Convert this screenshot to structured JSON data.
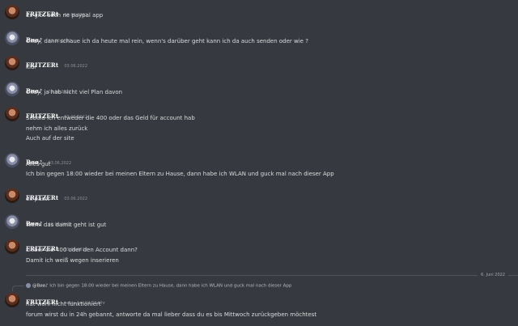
{
  "messages": [
    {
      "author": "FRITZERt",
      "date": "03.06.2022",
      "avatar": "fritzert-avatar",
      "lines": [
        "Es gibt auch ne paypal app"
      ]
    },
    {
      "author": "Bøø♪",
      "date": "03.06.2022",
      "avatar": "boo-avatar",
      "lines": [
        "Okay, dann schaue ich da heute mal rein, wenn's darüber geht kann ich da auch senden oder wie ?"
      ]
    },
    {
      "author": "FRITZERt",
      "date": "03.06.2022",
      "avatar": "fritzert-avatar",
      "lines": [
        "klar"
      ]
    },
    {
      "author": "Bøø♪",
      "date": "03.06.2022",
      "avatar": "boo-avatar",
      "lines": [
        "Okay, ja hab nicht viel Plan davon"
      ]
    },
    {
      "author": "FRITZERt",
      "date": "03.06.2022",
      "avatar": "fritzert-avatar",
      "lines": [
        "Sobald ich entweder die 400 oder das Geld für account hab",
        "nehm ich alles zurück",
        "Auch auf der site"
      ]
    },
    {
      "author": "Bøø♪",
      "date": "03.06.2022",
      "avatar": "boo-avatar",
      "lines": [
        "Alles gut",
        "Ich bin gegen 18:00 wieder bei meinen Eltern zu Hause, dann habe ich WLAN und guck mal nach dieser App"
      ]
    },
    {
      "author": "FRITZERt",
      "date": "03.06.2022",
      "avatar": "fritzert-avatar",
      "lines": [
        "ok passt"
      ]
    },
    {
      "author": "Bøø♪",
      "date": "03.06.2022",
      "avatar": "boo-avatar",
      "lines": [
        "Wenn das damit geht ist gut"
      ]
    },
    {
      "author": "FRITZERt",
      "date": "03.06.2022",
      "avatar": "fritzert-avatar",
      "lines": [
        "Lieber die 400 oder den Account dann?",
        "Damit ich weiß wegen inserieren"
      ]
    }
  ],
  "divider": {
    "label": "6. Juni 2022"
  },
  "reply": {
    "author": "@Bøø♪",
    "text": "Ich bin gegen 18:00 wieder bei meinen Eltern zu Hause, dann habe ich WLAN und guck mal nach dieser App"
  },
  "last_message": {
    "author": "FRITZERt",
    "date": "heute um 04:23 Uhr",
    "avatar": "fritzert-avatar",
    "lines": [
      "hat wohl nicht funktioniert",
      "forum wirst du in 24h gebannt, antworte da mal lieber dass du es bis Mittwoch zurückgeben möchtest"
    ]
  }
}
